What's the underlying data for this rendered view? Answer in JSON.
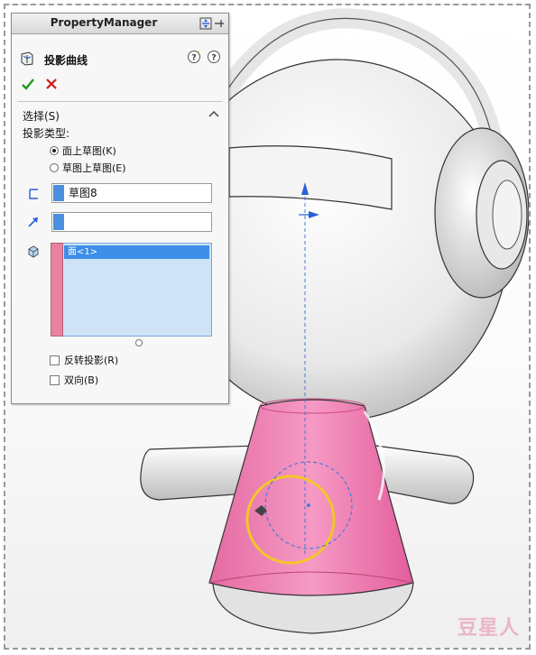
{
  "panel": {
    "title": "PropertyManager",
    "feature_title": "投影曲线",
    "section_title": "选择(S)",
    "projection_type_label": "投影类型:",
    "radio_options": [
      {
        "label": "面上草图(K)",
        "selected": true
      },
      {
        "label": "草图上草图(E)",
        "selected": false
      }
    ],
    "sketch_field_value": "草图8",
    "direction_field_value": "",
    "faces_list_items": [
      "面<1>"
    ],
    "checkboxes": [
      {
        "label": "反转投影(R)",
        "checked": false
      },
      {
        "label": "双向(B)",
        "checked": false
      }
    ],
    "icons": [
      "projected-curve-icon",
      "ok-check-icon",
      "cancel-x-icon",
      "help-icon",
      "question-icon",
      "pin-icon",
      "expand-icon",
      "chevron-up-icon",
      "sketch-icon",
      "direction-arrow-icon",
      "face-icon"
    ]
  },
  "colors": {
    "sketch_field_bar": "#4a8fe0",
    "direction_field_bar": "#4a8fe0",
    "faces_bar": "#e8829e",
    "list_selection": "#3d8ee6",
    "body_pink": "#e96aa6",
    "ok_green": "#1a9a1a",
    "cancel_red": "#d01818"
  },
  "watermark": "豆星人"
}
